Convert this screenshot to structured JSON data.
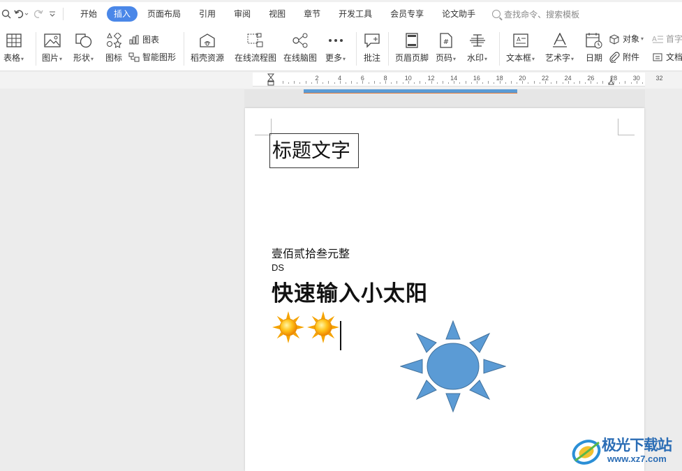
{
  "menu": {
    "tabs": [
      {
        "label": "开始"
      },
      {
        "label": "插入",
        "active": true
      },
      {
        "label": "页面布局"
      },
      {
        "label": "引用"
      },
      {
        "label": "审阅"
      },
      {
        "label": "视图"
      },
      {
        "label": "章节"
      },
      {
        "label": "开发工具"
      },
      {
        "label": "会员专享"
      },
      {
        "label": "论文助手"
      }
    ],
    "search_placeholder": "查找命令、搜索模板",
    "accent_color": "#4a87e8"
  },
  "ribbon": {
    "table": "表格",
    "picture": "图片",
    "shape": "形状",
    "icons": "图标",
    "chart": "图表",
    "smart_graphic": "智能图形",
    "docer_resources": "稻壳资源",
    "online_flowchart": "在线流程图",
    "online_mindmap": "在线脑图",
    "more": "更多",
    "comment": "批注",
    "header_footer": "页眉页脚",
    "page_number": "页码",
    "watermark": "水印",
    "textbox": "文本框",
    "wordart": "艺术字",
    "date": "日期",
    "object": "对象",
    "attachment": "附件",
    "drop_cap": "首字",
    "document": "文档"
  },
  "ruler": {
    "numbers": [
      "2",
      "4",
      "6",
      "8",
      "10",
      "12",
      "14",
      "16",
      "18",
      "20",
      "22",
      "24",
      "26",
      "28",
      "30",
      "32"
    ]
  },
  "document": {
    "title_text": "标题文字",
    "line1": "壹佰贰拾叁元整",
    "line2": "DS",
    "heading": "快速输入小太阳",
    "sun_emoji_count": 2,
    "sun_shape_color": "#5b9bd5",
    "sun_shape_outline": "#41719c"
  },
  "watermark": {
    "brand": "极光下载站",
    "url": "www.xz7.com"
  }
}
